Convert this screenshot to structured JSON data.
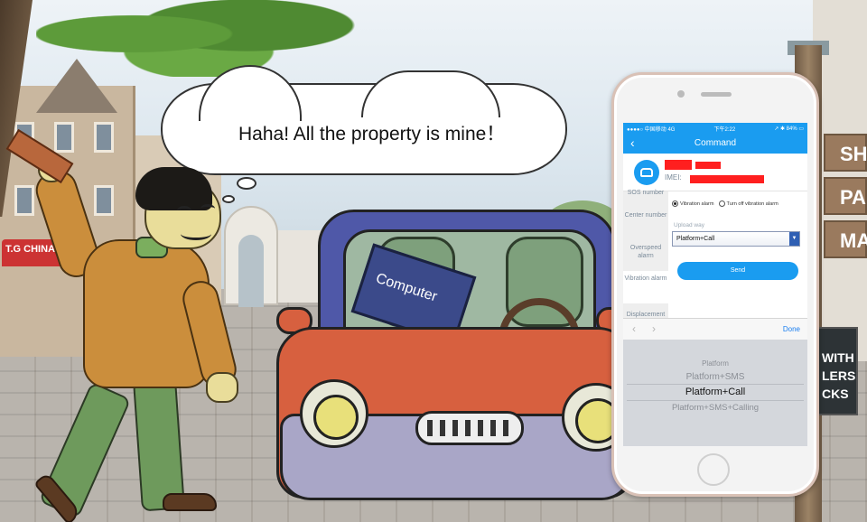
{
  "caption": "Haha! All the property is mine！",
  "laptop_label": "Computer",
  "shop_sign": "T.G CHINA",
  "right_signs": [
    "SH",
    "PA",
    "MA"
  ],
  "street_sign": [
    "WITH",
    "LERS",
    "CKS"
  ],
  "phone": {
    "status_bar": {
      "carrier": "●●●●○ 中国移动 4G",
      "time": "下午2:22",
      "battery": "↗ ✱ 84% ▭"
    },
    "nav": {
      "back_icon": "chevron-left-icon",
      "title": "Command"
    },
    "device": {
      "imei_label": "IMEI:",
      "avatar_icon": "car-icon"
    },
    "side_menu": [
      "SOS number",
      "Center number",
      "Overspeed alarm",
      "Vibration alarm",
      "Displacement"
    ],
    "radio_options": [
      "Vibration alarm",
      "Turn off vibration alarm"
    ],
    "upload_way": {
      "label": "Upload way",
      "value": "Platform+Call"
    },
    "send_label": "Send",
    "picker_toolbar": {
      "prev": "‹",
      "next": "›",
      "done": "Done"
    },
    "picker_options": [
      "Platform",
      "Platform+SMS",
      "Platform+Call",
      "Platform+SMS+Calling"
    ]
  },
  "colors": {
    "accent": "#1a9cf0",
    "redaction": "#ff1f1f"
  }
}
